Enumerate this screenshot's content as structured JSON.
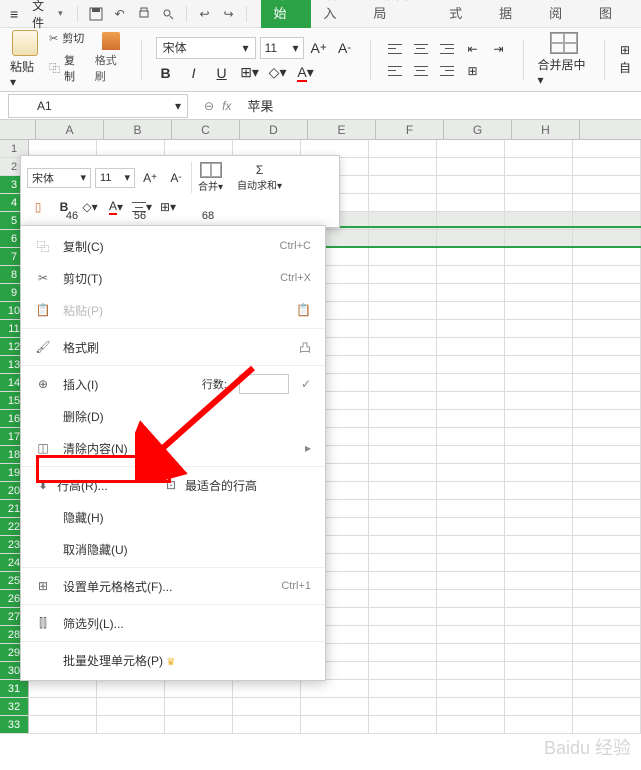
{
  "menubar": {
    "file_label": "文件"
  },
  "tabs": [
    "开始",
    "插入",
    "页面布局",
    "公式",
    "数据",
    "审阅",
    "视图"
  ],
  "ribbon": {
    "paste_label": "粘贴",
    "cut_label": "剪切",
    "copy_label": "复制",
    "format_brush_label": "格式刷",
    "font_name": "宋体",
    "font_size": "11",
    "bold": "B",
    "italic": "I",
    "underline": "U",
    "merge_center_label": "合并居中",
    "autosum_label": "自"
  },
  "formula_bar": {
    "name_box": "A1",
    "fx_label": "fx",
    "cell_value": "苹果"
  },
  "columns": [
    "A",
    "B",
    "C",
    "D",
    "E",
    "F",
    "G",
    "H"
  ],
  "rows": [
    1,
    2,
    3,
    4,
    5,
    6,
    7,
    8,
    9,
    10,
    11,
    12,
    13,
    14,
    15,
    16,
    17,
    18,
    19,
    20,
    21,
    22,
    23,
    24,
    25,
    26,
    27,
    28,
    29,
    30,
    31,
    32,
    33
  ],
  "col_widths": [
    "46",
    "56",
    "68"
  ],
  "mini_toolbar": {
    "font_name": "宋体",
    "font_size": "11",
    "merge_label": "合并",
    "autosum_label": "自动求和"
  },
  "context_menu": {
    "copy": "复制(C)",
    "copy_shortcut": "Ctrl+C",
    "cut": "剪切(T)",
    "cut_shortcut": "Ctrl+X",
    "paste": "粘贴(P)",
    "format_brush": "格式刷",
    "insert": "插入(I)",
    "insert_rows_label": "行数:",
    "delete": "删除(D)",
    "clear_contents": "清除内容(N)",
    "row_height": "行高(R)...",
    "best_fit_row_height": "最适合的行高",
    "hide": "隐藏(H)",
    "unhide": "取消隐藏(U)",
    "format_cells": "设置单元格格式(F)...",
    "format_cells_shortcut": "Ctrl+1",
    "filter_column": "筛选列(L)...",
    "batch_process": "批量处理单元格(P)"
  },
  "watermark": "Baidu 经验"
}
